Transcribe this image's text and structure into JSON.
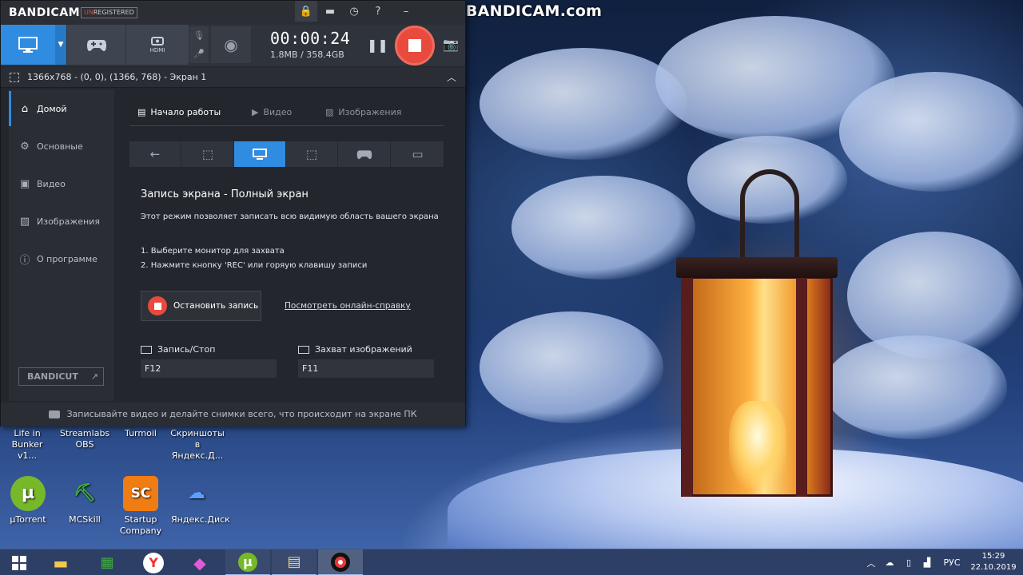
{
  "desktop": {
    "watermark": "www.BANDICAM.com",
    "icons": [
      {
        "label": "Life in Bunker v1...",
        "glyph": "",
        "color": "#6b3b2a"
      },
      {
        "label": "Streamlabs OBS",
        "glyph": "",
        "color": "#31c3a2"
      },
      {
        "label": "Turmoil",
        "glyph": "",
        "color": "#8a5a2a"
      },
      {
        "label": "Скриншоты в Яндекс.Д...",
        "glyph": "",
        "color": "#4a8de8"
      },
      {
        "label": "µTorrent",
        "glyph": "µ",
        "color": "#76b82a"
      },
      {
        "label": "MCSkill",
        "glyph": "⛏",
        "color": "#2f5d2f"
      },
      {
        "label": "Startup Company",
        "glyph": "SC",
        "color": "#f07c14"
      },
      {
        "label": "Яндекс.Диск",
        "glyph": "☁",
        "color": "#2d7de0"
      }
    ]
  },
  "window": {
    "logo": "BANDICAM",
    "unregistered_un": "UN",
    "unregistered_rest": "REGISTERED",
    "titlebar_icons": [
      "lock-icon",
      "folder-icon",
      "clock-icon",
      "help-icon",
      "minimize-icon",
      "close-icon"
    ],
    "timer": "00:00:24",
    "size": "1.8MB / 358.4GB",
    "target": "1366x768 - (0, 0), (1366, 768) - Экран 1",
    "sidebar": [
      {
        "label": "Домой",
        "icon": "home-icon"
      },
      {
        "label": "Основные",
        "icon": "gear-icon"
      },
      {
        "label": "Видео",
        "icon": "video-icon"
      },
      {
        "label": "Изображения",
        "icon": "image-icon"
      },
      {
        "label": "О программе",
        "icon": "info-icon"
      }
    ],
    "bandicut": "BANDICUT",
    "tabs": [
      {
        "label": "Начало работы"
      },
      {
        "label": "Видео"
      },
      {
        "label": "Изображения"
      }
    ],
    "content": {
      "title": "Запись экрана - Полный экран",
      "description": "Этот режим позволяет записать всю видимую область вашего экрана",
      "step1": "1. Выберите монитор для захвата",
      "step2": "2. Нажмите кнопку 'REC' или горяую клавишу записи",
      "stop_button": "Остановить запись",
      "help_link": "Посмотреть онлайн-справку",
      "hotkey_record_label": "Запись/Стоп",
      "hotkey_record_value": "F12",
      "hotkey_capture_label": "Захват изображений",
      "hotkey_capture_value": "F11"
    },
    "status": "Записывайте видео и делайте снимки всего, что происходит на экране ПК"
  },
  "taskbar": {
    "language": "РУС",
    "time": "15:29",
    "date": "22.10.2019"
  },
  "colors": {
    "accent": "#2f8ce1",
    "record": "#e84a3d"
  }
}
